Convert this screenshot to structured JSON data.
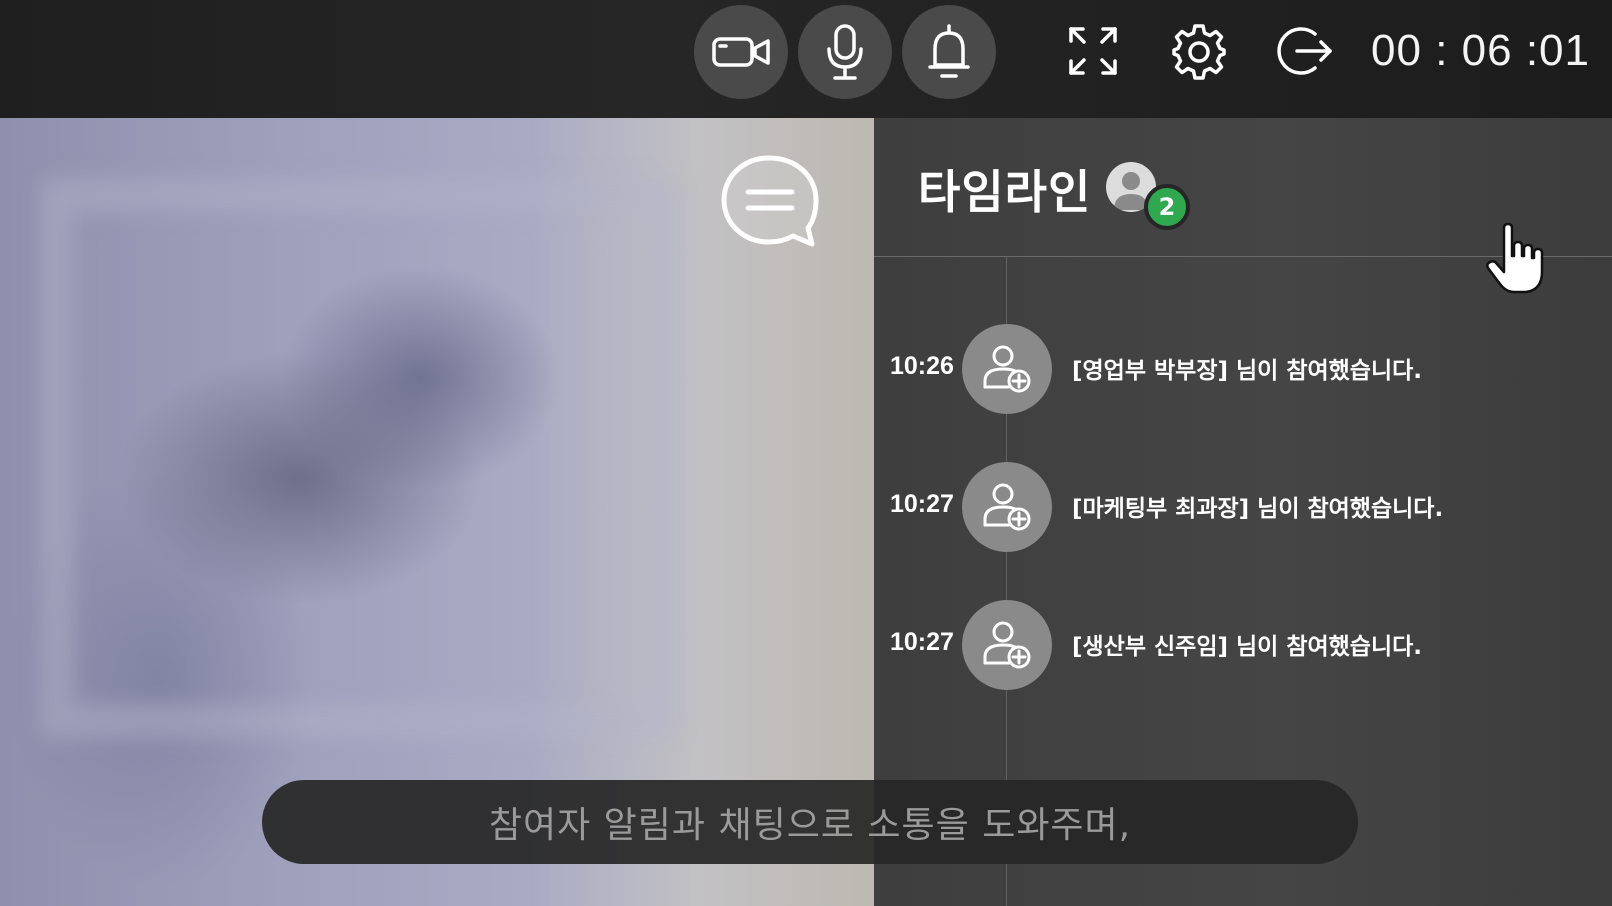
{
  "topbar": {
    "buttons": [
      {
        "name": "camera",
        "icon": "video-camera-icon"
      },
      {
        "name": "microphone",
        "icon": "microphone-icon"
      },
      {
        "name": "notification",
        "icon": "bell-icon"
      },
      {
        "name": "fullscreen",
        "icon": "expand-icon"
      },
      {
        "name": "settings",
        "icon": "gear-icon"
      },
      {
        "name": "exit",
        "icon": "logout-icon"
      }
    ],
    "timer": "00 : 06 :01"
  },
  "video": {
    "chat_toggle_icon": "chat-bubble-icon"
  },
  "timeline": {
    "title": "타임라인",
    "participant_count": "2",
    "badge_color": "#2fa84f",
    "events": [
      {
        "time": "10:26",
        "icon": "user-add-icon",
        "message": "[영업부 박부장] 님이 참여했습니다."
      },
      {
        "time": "10:27",
        "icon": "user-add-icon",
        "message": "[마케팅부 최과장] 님이 참여했습니다."
      },
      {
        "time": "10:27",
        "icon": "user-add-icon",
        "message": "[생산부 신주임] 님이 참여했습니다."
      }
    ]
  },
  "caption": {
    "text": "참여자 알림과 채팅으로 소통을 도와주며,"
  }
}
